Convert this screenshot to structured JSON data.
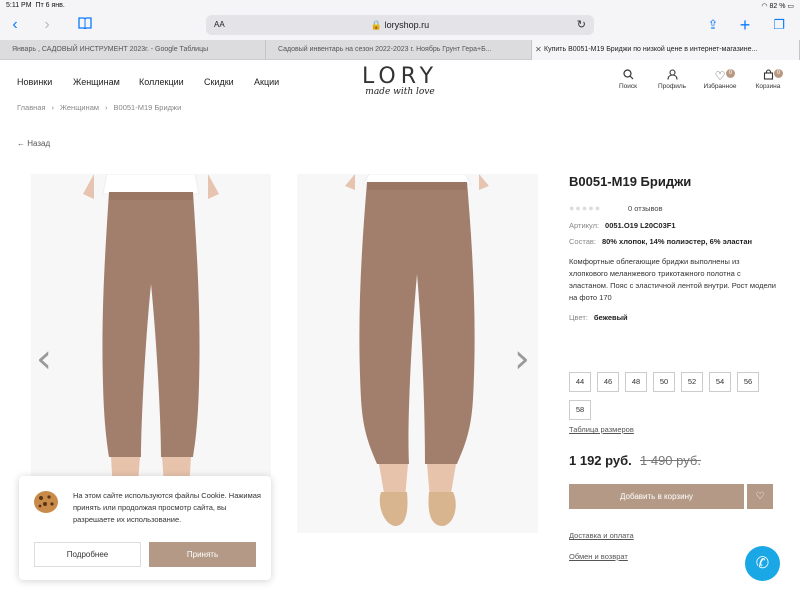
{
  "status_bar": {
    "time": "5:11 PM",
    "date": "Пт 6 янв.",
    "battery": "82 %"
  },
  "browser": {
    "url": "loryshop.ru",
    "aa": "AA",
    "tabs": [
      {
        "label": "Январь , САДОВЫЙ ИНСТРУМЕНТ 2023г. - Google Таблицы"
      },
      {
        "label": "Садовый инвентарь на сезон 2022-2023 г. Ноябрь Грунт Гера+Б..."
      },
      {
        "label": "Купить В0051-М19 Бриджи по низкой цене в интернет-магазине..."
      }
    ]
  },
  "header": {
    "menu": [
      "Новинки",
      "Женщинам",
      "Коллекции",
      "Скидки",
      "Акции"
    ],
    "logo": "LORY",
    "logo_sub": "made with love",
    "icons": [
      {
        "label": "Поиск",
        "icon": "search-icon"
      },
      {
        "label": "Профиль",
        "icon": "profile-icon"
      },
      {
        "label": "Избранное",
        "icon": "heart-icon",
        "badge": "0"
      },
      {
        "label": "Корзина",
        "icon": "cart-icon",
        "badge": "0"
      }
    ]
  },
  "breadcrumbs": [
    "Главная",
    "Женщинам",
    "В0051-М19 Бриджи"
  ],
  "back_label": "Назад",
  "product": {
    "title": "В0051-М19 Бриджи",
    "reviews": "0 отзывов",
    "article_label": "Артикул:",
    "article": "0051.О19 L20C03F1",
    "composition_label": "Состав:",
    "composition": "80% хлопок, 14% полиэстер, 6% эластан",
    "description": "Комфортные облегающие бриджи выполнены из хлопкового меланжевого трикотажного полотна с эластаном. Пояс с эластичной лентой внутри. Рост модели на фото 170",
    "color_label": "Цвет:",
    "color": "бежевый",
    "sizes": [
      "44",
      "46",
      "48",
      "50",
      "52",
      "54",
      "56",
      "58"
    ],
    "size_chart": "Таблица размеров",
    "price": "1 192 руб.",
    "old_price": "1 490 руб.",
    "add_to_cart": "Добавить в корзину",
    "delivery": "Доставка и оплата",
    "exchange": "Обмен и возврат"
  },
  "cookie": {
    "text": "На этом сайте используются файлы Cookie. Нажимая принять или продолжая просмотр сайта, вы разрешаете их использование.",
    "more": "Подробнее",
    "accept": "Принять"
  },
  "colors": {
    "accent": "#b49a86",
    "fabric": "#a27f6c",
    "call": "#1aa7e6"
  }
}
